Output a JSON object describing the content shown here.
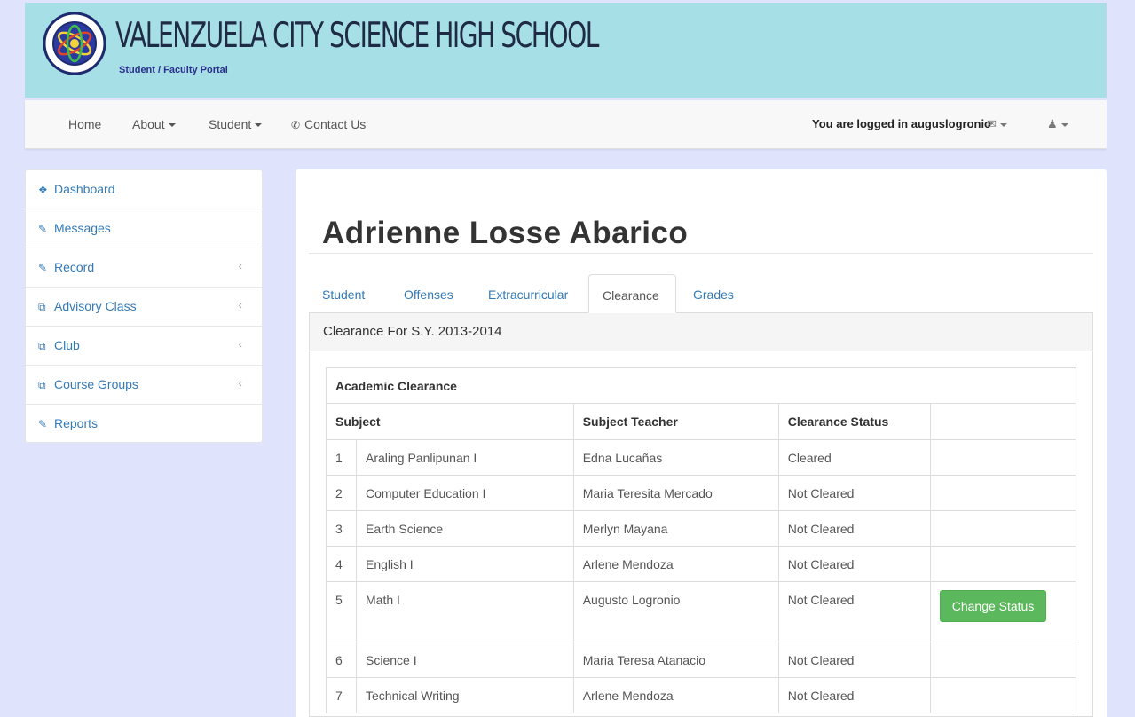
{
  "header": {
    "school_name": "VALENZUELA CITY SCIENCE HIGH SCHOOL",
    "subtitle": "Student / Faculty Portal"
  },
  "navbar": {
    "items": [
      {
        "label": "Home"
      },
      {
        "label": "About"
      },
      {
        "label": "Student"
      },
      {
        "label": "Contact Us",
        "icon": "phone-icon"
      }
    ],
    "logged_in_text": "You are logged in auguslogronio",
    "icons": [
      "envelope-icon",
      "user-icon"
    ]
  },
  "sidebar": {
    "items": [
      {
        "label": "Dashboard",
        "icon": "dashboard-icon"
      },
      {
        "label": "Messages",
        "icon": "edit-icon"
      },
      {
        "label": "Record",
        "icon": "edit-icon"
      },
      {
        "label": "Advisory Class",
        "icon": "copy-icon"
      },
      {
        "label": "Club",
        "icon": "copy-icon"
      },
      {
        "label": "Course Groups",
        "icon": "copy-icon"
      },
      {
        "label": "Reports",
        "icon": "edit-icon"
      }
    ]
  },
  "main": {
    "student_name": "Adrienne Losse Abarico",
    "tabs": [
      {
        "label": "Student"
      },
      {
        "label": "Offenses"
      },
      {
        "label": "Extracurricular"
      },
      {
        "label": "Clearance",
        "active": true
      },
      {
        "label": "Grades"
      }
    ],
    "panel_title": "Clearance For S.Y. 2013-2014",
    "table": {
      "caption": "Academic Clearance",
      "headers": [
        "Subject",
        "Subject Teacher",
        "Clearance Status"
      ],
      "rows": [
        {
          "num": "1",
          "subject": "Araling Panlipunan I",
          "teacher": "Edna Lucañas",
          "status": "Cleared"
        },
        {
          "num": "2",
          "subject": "Computer Education I",
          "teacher": "Maria Teresita Mercado",
          "status": "Not Cleared"
        },
        {
          "num": "3",
          "subject": "Earth Science",
          "teacher": "Merlyn Mayana",
          "status": "Not Cleared"
        },
        {
          "num": "4",
          "subject": "English I",
          "teacher": "Arlene Mendoza",
          "status": "Not Cleared"
        },
        {
          "num": "5",
          "subject": "Math I",
          "teacher": "Augusto Logronio",
          "status": "Not Cleared",
          "action": "Change Status"
        },
        {
          "num": "6",
          "subject": "Science I",
          "teacher": "Maria Teresa Atanacio",
          "status": "Not Cleared"
        },
        {
          "num": "7",
          "subject": "Technical Writing",
          "teacher": "Arlene Mendoza",
          "status": "Not Cleared"
        }
      ]
    }
  },
  "colors": {
    "banner": "#a6dfe5",
    "page_bg": "#dfe3fb",
    "link": "#337ab7",
    "success_button": "#5cb85c"
  }
}
